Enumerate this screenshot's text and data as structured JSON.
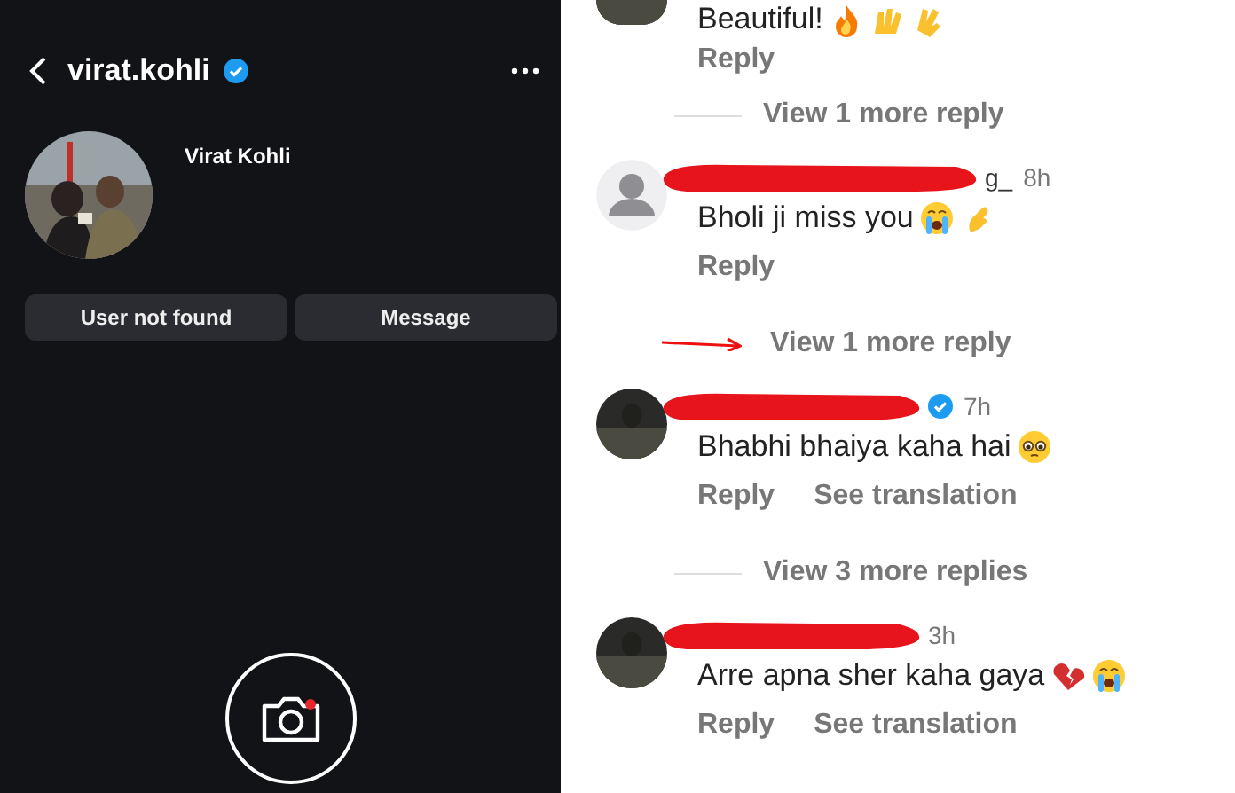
{
  "profile": {
    "username": "virat.kohli",
    "verified": true,
    "display_name": "Virat Kohli",
    "buttons": [
      {
        "label": "User not found"
      },
      {
        "label": "Message"
      }
    ]
  },
  "comments": [
    {
      "kind": "comment",
      "avatar": {
        "kind": "picture"
      },
      "cut_top": true,
      "text": "Beautiful!",
      "emojis": [
        {
          "kind": "fire"
        },
        {
          "kind": "hands"
        },
        {
          "kind": "clap"
        }
      ],
      "actions": [
        "Reply"
      ]
    },
    {
      "kind": "more",
      "text": "View 1 more reply",
      "arrow": false
    },
    {
      "kind": "comment",
      "avatar": {
        "kind": "default"
      },
      "redacted": true,
      "username": "g_",
      "time": "8h",
      "text": "Bholi ji miss you",
      "emojis": [
        {
          "kind": "crying"
        },
        {
          "kind": "pinch"
        }
      ],
      "actions": [
        "Reply"
      ]
    },
    {
      "kind": "more",
      "text": "View 1 more reply",
      "arrow": true
    },
    {
      "kind": "comment",
      "avatar": {
        "kind": "picture"
      },
      "redacted": true,
      "verified": true,
      "time": "7h",
      "text": "Bhabhi bhaiya kaha hai",
      "emojis": [
        {
          "kind": "pleading"
        }
      ],
      "actions": [
        "Reply",
        "See translation"
      ]
    },
    {
      "kind": "more",
      "text": "View 3 more replies",
      "arrow": false
    },
    {
      "kind": "comment",
      "avatar": {
        "kind": "picture"
      },
      "redacted": true,
      "time": "3h",
      "text": "Arre apna sher kaha gaya",
      "emojis": [
        {
          "kind": "broken-heart"
        },
        {
          "kind": "crying"
        }
      ],
      "actions": [
        "Reply",
        "See translation"
      ]
    }
  ]
}
